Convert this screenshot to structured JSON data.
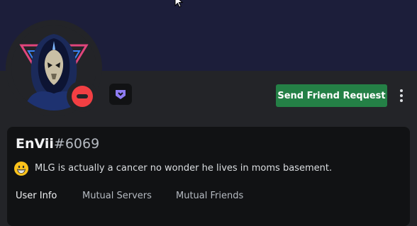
{
  "profile": {
    "username": "EnVii",
    "discriminator": "#6069",
    "status_emoji": "grinning-face",
    "custom_status": "MLG is actually a cancer no wonder he lives in moms basement.",
    "presence": "do-not-disturb",
    "badge": "nitro-badge"
  },
  "actions": {
    "send_friend_request": "Send Friend Request",
    "more_icon": "more-vertical-icon"
  },
  "tabs": [
    {
      "label": "User Info",
      "active": true
    },
    {
      "label": "Mutual Servers",
      "active": false
    },
    {
      "label": "Mutual Friends",
      "active": false
    }
  ],
  "colors": {
    "banner": "#1c1e3a",
    "background": "#232428",
    "card": "#111214",
    "friend_button": "#248046",
    "dnd": "#f23f43",
    "badge": "#8e7cf4"
  }
}
